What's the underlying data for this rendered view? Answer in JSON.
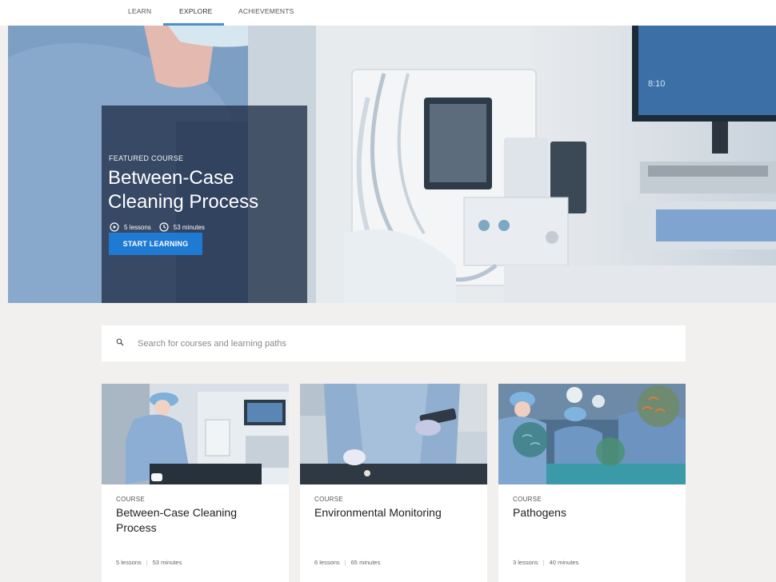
{
  "nav": {
    "tabs": [
      {
        "label": "LEARN"
      },
      {
        "label": "EXPLORE"
      },
      {
        "label": "ACHIEVEMENTS"
      }
    ],
    "active_tab": "EXPLORE"
  },
  "hero": {
    "eyebrow": "FEATURED COURSE",
    "title": "Between-Case Cleaning Process",
    "lessons": "5 lessons",
    "duration": "53 minutes",
    "cta": "START LEARNING",
    "monitor_clock": "8:10"
  },
  "search": {
    "placeholder": "Search for courses and learning paths",
    "value": ""
  },
  "cards": [
    {
      "kind": "COURSE",
      "title": "Between-Case Cleaning Process",
      "lessons": "5 lessons",
      "duration": "53 minutes"
    },
    {
      "kind": "COURSE",
      "title": "Environmental Monitoring",
      "lessons": "6 lessons",
      "duration": "65 minutes"
    },
    {
      "kind": "COURSE",
      "title": "Pathogens",
      "lessons": "3 lessons",
      "duration": "40 minutes"
    }
  ],
  "colors": {
    "accent": "#1f7ad3",
    "tab_underline": "#4a90c8",
    "hero_overlay": "#202e46",
    "page_background": "#f1f0ee"
  },
  "icons": {
    "lessons": "play-circle-icon",
    "duration": "clock-icon",
    "search": "search-icon"
  }
}
